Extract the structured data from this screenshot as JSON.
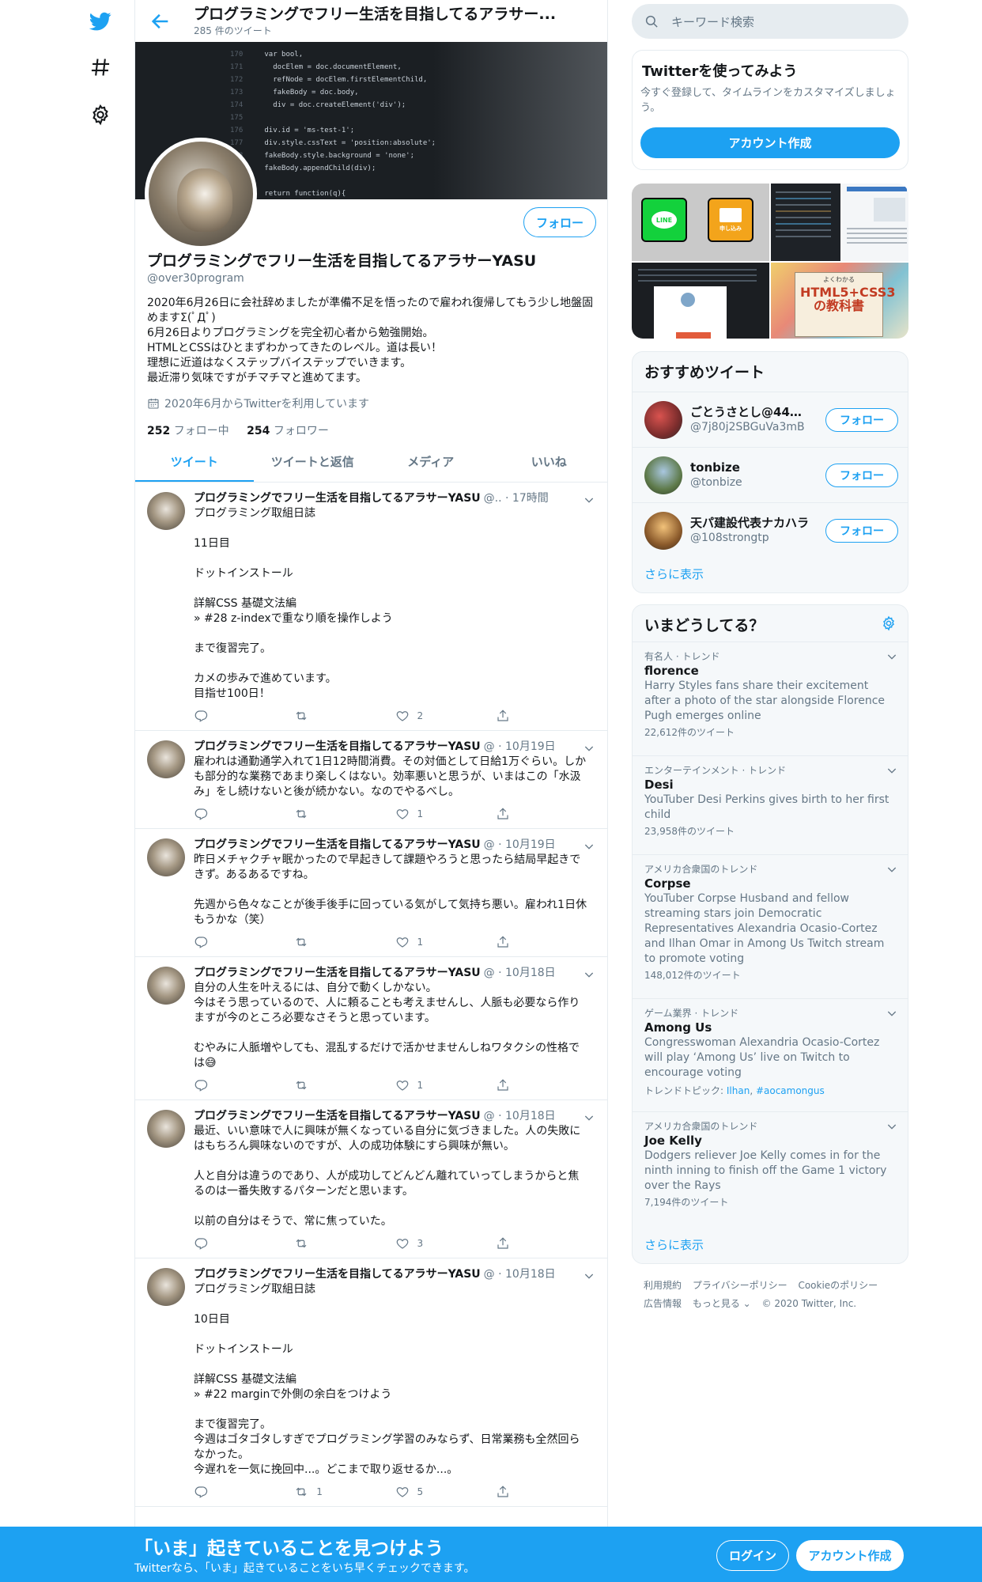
{
  "header": {
    "title": "プログラミングでフリー生活を目指してるアラサー...",
    "tweet_count": "285 件のツイート"
  },
  "profile": {
    "name": "プログラミングでフリー生活を目指してるアラサーYASU",
    "handle": "@over30program",
    "bio": "2020年6月26日に会社辞めましたが準備不足を悟ったので雇われ復帰してもう少し地盤固めますΣ(ﾟДﾟ)\n6月26日よりプログラミングを完全初心者から勉強開始。\nHTMLとCSSはひとまずわかってきたのレベル。道は長い！\n理想に近道はなくステップバイステップでいきます。\n最近滞り気味ですがチマチマと進めてます。",
    "joined": "2020年6月からTwitterを利用しています",
    "following_count": "252",
    "following_label": "フォロー中",
    "followers_count": "254",
    "followers_label": "フォロワー",
    "follow_label": "フォロー"
  },
  "tabs": [
    {
      "label": "ツイート",
      "active": true
    },
    {
      "label": "ツイートと返信",
      "active": false
    },
    {
      "label": "メディア",
      "active": false
    },
    {
      "label": "いいね",
      "active": false
    }
  ],
  "tweets": [
    {
      "name": "プログラミングでフリー生活を目指してるアラサーYASU",
      "meta": "@.. · 17時間",
      "text": "プログラミング取組日誌\n\n11日目\n\nドットインストール\n\n詳解CSS 基礎文法編\n» #28 z-indexで重なり順を操作しよう\n\nまで復習完了。\n\nカメの歩みで進めています。\n目指せ100日！",
      "replies": "",
      "retweets": "",
      "likes": "2"
    },
    {
      "name": "プログラミングでフリー生活を目指してるアラサーYASU",
      "meta": "@ · 10月19日",
      "text": "雇われは通勤通学入れて1日12時間消費。その対価として日給1万ぐらい。しかも部分的な業務であまり楽しくはない。効率悪いと思うが、いまはこの「水汲み」をし続けないと後が続かない。なのでやるべし。",
      "replies": "",
      "retweets": "",
      "likes": "1"
    },
    {
      "name": "プログラミングでフリー生活を目指してるアラサーYASU",
      "meta": "@ · 10月19日",
      "text": "昨日メチャクチャ眠かったので早起きして課題やろうと思ったら結局早起きできず。あるあるですね。\n\n先週から色々なことが後手後手に回っている気がして気持ち悪い。雇われ1日休もうかな（笑）",
      "replies": "",
      "retweets": "",
      "likes": "1"
    },
    {
      "name": "プログラミングでフリー生活を目指してるアラサーYASU",
      "meta": "@ · 10月18日",
      "text": "自分の人生を叶えるには、自分で動くしかない。\n今はそう思っているので、人に頼ることも考えませんし、人脈も必要なら作りますが今のところ必要なさそうと思っています。\n\nむやみに人脈増やしても、混乱するだけで活かせませんしねワタクシの性格では😅",
      "replies": "",
      "retweets": "",
      "likes": "1"
    },
    {
      "name": "プログラミングでフリー生活を目指してるアラサーYASU",
      "meta": "@ · 10月18日",
      "text": "最近、いい意味で人に興味が無くなっている自分に気づきました。人の失敗にはもちろん興味ないのですが、人の成功体験にすら興味が無い。\n\n人と自分は違うのであり、人が成功してどんどん離れていってしまうからと焦るのは一番失敗するパターンだと思います。\n\n以前の自分はそうで、常に焦っていた。",
      "replies": "",
      "retweets": "",
      "likes": "3"
    },
    {
      "name": "プログラミングでフリー生活を目指してるアラサーYASU",
      "meta": "@ · 10月18日",
      "text": "プログラミング取組日誌\n\n10日目\n\nドットインストール\n\n詳解CSS 基礎文法編\n» #22 marginで外側の余白をつけよう\n\nまで復習完了。\n今週はゴタゴタしすぎでプログラミング学習のみならず、日常業務も全然回らなかった。\n今遅れを一気に挽回中...。どこまで取り返せるか...。",
      "replies": "",
      "retweets": "1",
      "likes": "5"
    }
  ],
  "search": {
    "placeholder": "キーワード検索"
  },
  "signup_card": {
    "title": "Twitterを使ってみよう",
    "desc": "今すぐ登録して、タイムラインをカスタマイズしましょう。",
    "button": "アカウント作成"
  },
  "media_tiles": {
    "line_label": "LINE",
    "mail_label": "申し込み",
    "book_title": "HTML5+CSS3の教科書",
    "book_kicker": "よくわかる"
  },
  "recommended": {
    "title": "おすすめツイート",
    "users": [
      {
        "name": "ごとうさとし@44歳...",
        "handle": "@7j80j2SBGuVa3mB",
        "button": "フォロー"
      },
      {
        "name": "tonbize",
        "handle": "@tonbize",
        "button": "フォロー"
      },
      {
        "name": "天パ建設代表ナカハラ",
        "handle": "@108strongtp",
        "button": "フォロー"
      }
    ],
    "more": "さらに表示"
  },
  "trends": {
    "title": "いまどうしてる？",
    "items": [
      {
        "category": "有名人 · トレンド",
        "name": "florence",
        "desc": "Harry Styles fans share their excitement after a photo of the star alongside Florence Pugh emerges online",
        "count": "22,612件のツイート"
      },
      {
        "category": "エンターテインメント · トレンド",
        "name": "Desi",
        "desc": "YouTuber Desi Perkins gives birth to her first child",
        "count": "23,958件のツイート"
      },
      {
        "category": "アメリカ合衆国のトレンド",
        "name": "Corpse",
        "desc": "YouTuber Corpse Husband and fellow streaming stars join Democratic Representatives Alexandria Ocasio-Cortez and Ilhan Omar in Among Us Twitch stream to promote voting",
        "count": "148,012件のツイート"
      },
      {
        "category": "ゲーム業界 · トレンド",
        "name": "Among Us",
        "desc": "Congresswoman Alexandria Ocasio-Cortez will play ‘Among Us’ live on Twitch to encourage voting",
        "topics_label": "トレンドトピック:",
        "topic1": "Ilhan",
        "topic2": "#aocamongus"
      },
      {
        "category": "アメリカ合衆国のトレンド",
        "name": "Joe Kelly",
        "desc": "Dodgers reliever Joe Kelly comes in for the ninth inning to finish off the Game 1 victory over the Rays",
        "count": "7,194件のツイート"
      }
    ],
    "more": "さらに表示"
  },
  "footer": {
    "terms": "利用規約",
    "privacy": "プライバシーポリシー",
    "cookie": "Cookieのポリシー",
    "ads": "広告情報",
    "more": "もっと見る ⌄",
    "copyright": "© 2020 Twitter, Inc."
  },
  "bottombar": {
    "title": "「いま」起きていることを見つけよう",
    "sub": "Twitterなら、「いま」起きていることをいち早くチェックできます。",
    "login": "ログイン",
    "signup": "アカウント作成"
  },
  "colors": {
    "accent": "#1da1f2",
    "muted": "#657786",
    "border": "#e6ecf0"
  }
}
